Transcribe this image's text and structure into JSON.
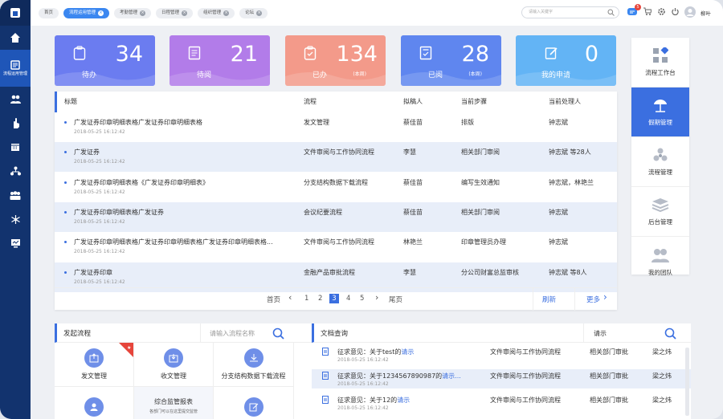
{
  "topbar": {
    "tabs": [
      {
        "label": "首页",
        "closable": false
      },
      {
        "label": "流程运用管理",
        "closable": true,
        "active": true
      },
      {
        "label": "考勤管理",
        "closable": true
      },
      {
        "label": "日程管理",
        "closable": true
      },
      {
        "label": "组织管理",
        "closable": true
      },
      {
        "label": "论坛",
        "closable": true
      }
    ],
    "search_placeholder": "请输入关键字",
    "notification_count": "5",
    "user_name": "柳叶"
  },
  "sidebar": {
    "active_label": "流程运用管理",
    "icons": [
      "home-icon",
      "process-icon",
      "users-icon",
      "hand-icon",
      "calendar-icon",
      "org-icon",
      "team-icon",
      "network-icon",
      "monitor-icon"
    ]
  },
  "stats": [
    {
      "label": "待办",
      "value": "34",
      "sub": "",
      "color": "#6b7cf0"
    },
    {
      "label": "待阅",
      "value": "21",
      "sub": "",
      "color": "#b27ce9"
    },
    {
      "label": "已办",
      "value": "134",
      "sub": "(本周)",
      "color": "#f39a8a"
    },
    {
      "label": "已阅",
      "value": "28",
      "sub": "(本周)",
      "color": "#5f86ef"
    },
    {
      "label": "我的申请",
      "value": "0",
      "sub": "",
      "color": "#63b4f5"
    }
  ],
  "list": {
    "headers": [
      "标题",
      "流程",
      "拟稿人",
      "当前步骤",
      "当前处理人"
    ],
    "rows": [
      {
        "title": "广发证券印章明细表格广发证券印章明细表格",
        "date": "2018-05-25 16:12:42",
        "flow": "发文管理",
        "drafter": "蔡佳苗",
        "step": "排版",
        "handler": "钟志斌"
      },
      {
        "title": "广发证券",
        "date": "2018-05-25 16:12:42",
        "flow": "文件审阅与工作协同流程",
        "drafter": "李慧",
        "step": "相关部门审阅",
        "handler": "钟志斌 等28人"
      },
      {
        "title": "广发证券印章明细表格《广发证券印章明细表》",
        "date": "2018-05-25 16:12:42",
        "flow": "分支结构数据下载流程",
        "drafter": "蔡佳苗",
        "step": "编写生效通知",
        "handler": "钟志斌，林艳兰"
      },
      {
        "title": "广发证券印章明细表格广发证券",
        "date": "2018-05-25 16:12:42",
        "flow": "会议纪要流程",
        "drafter": "蔡佳苗",
        "step": "相关部门审阅",
        "handler": "钟志斌"
      },
      {
        "title": "广发证券印章明细表格广发证券印章明细表格广发证券印章明细表格...",
        "date": "2018-05-25 16:12:42",
        "flow": "文件审阅与工作协同流程",
        "drafter": "林艳兰",
        "step": "印章管理员办理",
        "handler": "钟志斌"
      },
      {
        "title": "广发证券印章",
        "date": "2018-05-25 16:12:42",
        "flow": "金融产品审批流程",
        "drafter": "李慧",
        "step": "分公司财富总监审核",
        "handler": "钟志斌 等8人"
      }
    ],
    "pager": {
      "first": "首页",
      "pages": [
        "1",
        "2",
        "3",
        "4",
        "5"
      ],
      "current": "3",
      "last": "尾页",
      "refresh": "刷新",
      "more": "更多"
    }
  },
  "rightbar": [
    {
      "label": "流程工作台",
      "icon": "grid-icon"
    },
    {
      "label": "假期管理",
      "icon": "beach-icon",
      "active": true
    },
    {
      "label": "流程管理",
      "icon": "cycle-icon"
    },
    {
      "label": "后台管理",
      "icon": "layers-icon"
    },
    {
      "label": "我的团队",
      "icon": "team-icon"
    }
  ],
  "launch": {
    "title": "发起流程",
    "search_placeholder": "请输入流程名称",
    "tiles": [
      {
        "label": "发文管理",
        "starred": true
      },
      {
        "label": "收文管理"
      },
      {
        "label": "分支结构数据下载流程"
      },
      {
        "label": ""
      },
      {
        "label": "综合监管报表",
        "note": "各部门可以在这里提交监管"
      },
      {
        "label": ""
      }
    ]
  },
  "docs": {
    "title": "文档查询",
    "filter_label": "请示",
    "rows": [
      {
        "prefix": "征求意见：关于test的",
        "link": "请示",
        "date": "2018-05-25 16:12:42",
        "flow": "文件审阅与工作协同流程",
        "step": "相关部门审批",
        "person": "梁之炜"
      },
      {
        "prefix": "征求意见：关于1234567890987的",
        "link": "请示...",
        "date": "2018-05-25 16:12:42",
        "flow": "文件审阅与工作协同流程",
        "step": "相关部门审批",
        "person": "梁之炜"
      },
      {
        "prefix": "征求意见：关于12的",
        "link": "请示",
        "date": "2018-05-25 16:12:42",
        "flow": "文件审阅与工作协同流程",
        "step": "相关部门审批",
        "person": "梁之炜"
      }
    ]
  }
}
